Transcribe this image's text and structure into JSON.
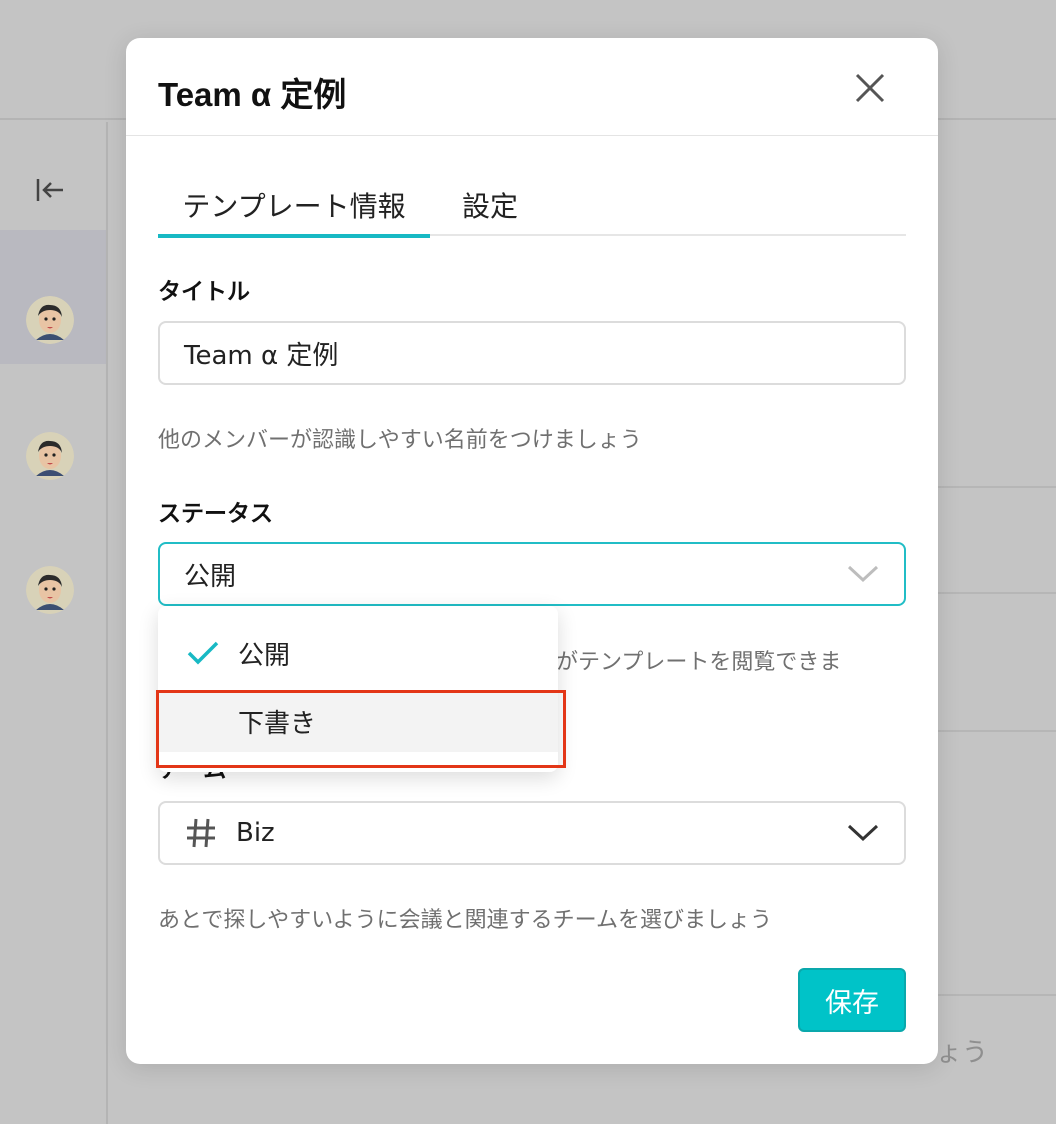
{
  "background": {
    "partial_text": "ょう"
  },
  "modal": {
    "title": "Team α 定例",
    "tabs": [
      {
        "label": "テンプレート情報",
        "active": true
      },
      {
        "label": "設定",
        "active": false
      }
    ],
    "title_field": {
      "label": "タイトル",
      "value": "Team α 定例",
      "hint": "他のメンバーが認識しやすい名前をつけましょう"
    },
    "status_field": {
      "label": "ステータス",
      "value": "公開",
      "hint_partial": "がテンプレートを閲覧できま",
      "options": [
        {
          "label": "公開",
          "selected": true
        },
        {
          "label": "下書き",
          "selected": false
        }
      ]
    },
    "team_field": {
      "label_partial": "チーム",
      "value": "Biz",
      "hint": "あとで探しやすいように会議と関連するチームを選びましょう"
    },
    "save_label": "保存"
  },
  "colors": {
    "accent": "#18b9c4",
    "button": "#00c3c8",
    "highlight": "#e33617"
  },
  "icons": {
    "close": "close-icon",
    "collapse": "collapse-sidebar-icon",
    "check": "check-icon",
    "hash": "hash-icon",
    "chevron": "chevron-down-icon"
  }
}
